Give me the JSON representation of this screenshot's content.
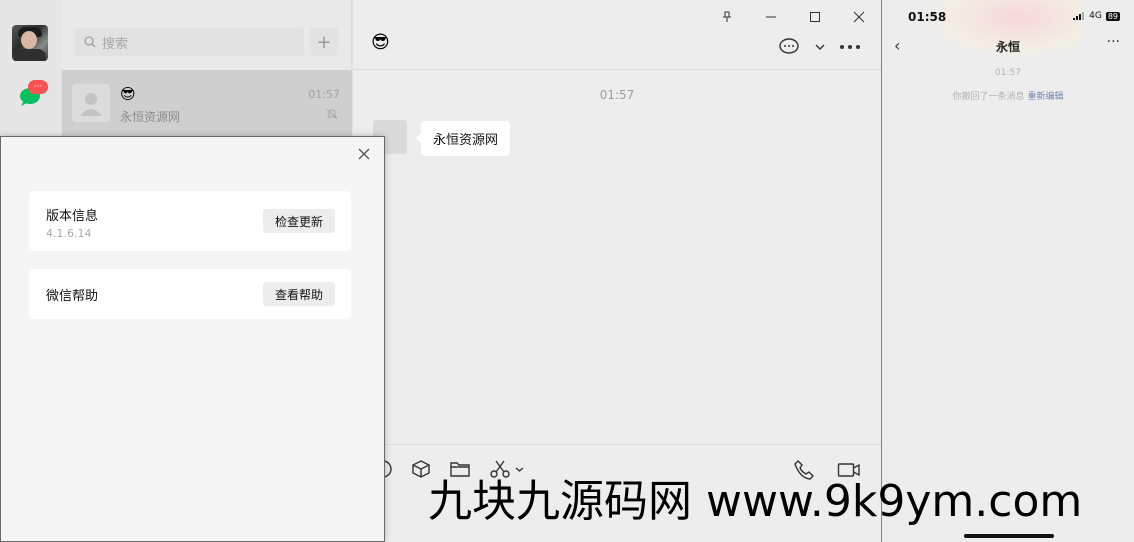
{
  "sidebar": {
    "avatar": "user-avatar",
    "chat_icon": "chat-icon",
    "chat_badge": "···"
  },
  "chat_list": {
    "search_placeholder": "搜索",
    "add_button": "+",
    "items": [
      {
        "name_emoji": "😎",
        "preview": "永恒资源网",
        "time": "01:57",
        "muted": true
      }
    ]
  },
  "chat_window": {
    "title": "😎",
    "window_buttons": [
      "pin",
      "minimize",
      "maximize",
      "close"
    ],
    "message_time": "01:57",
    "messages": [
      {
        "sender": "self-contact",
        "text": "永恒资源网"
      }
    ],
    "toolbar_left": [
      "emoji-icon",
      "sticker-icon",
      "folder-icon",
      "scissors-icon"
    ],
    "toolbar_right": [
      "phone-icon",
      "video-icon"
    ]
  },
  "phone": {
    "clock": "01:58",
    "signal": "4G",
    "battery": "89",
    "title": "永恒",
    "time": "01:57",
    "recall_text": "你撤回了一条消息",
    "recall_edit": "重新编辑"
  },
  "dialog": {
    "version_title": "版本信息",
    "version_number": "4.1.6.14",
    "check_update": "检查更新",
    "help_title": "微信帮助",
    "view_help": "查看帮助"
  },
  "watermark": "九块九源码网 www.9k9ym.com",
  "colors": {
    "accent_green": "#07c160",
    "badge_red": "#fa5151",
    "window_border": "#4f8fd6"
  }
}
